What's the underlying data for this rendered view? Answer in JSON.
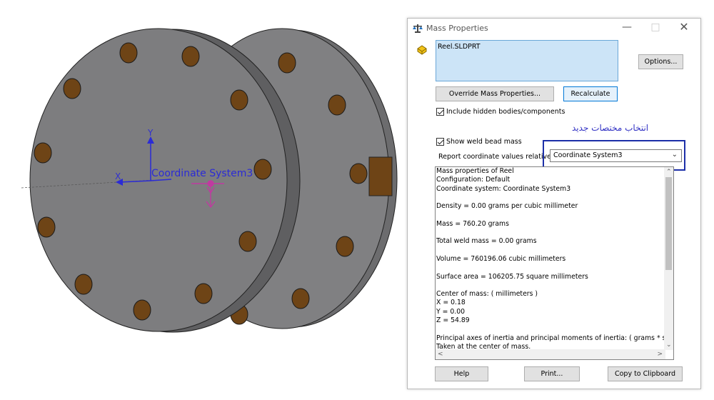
{
  "viewport": {
    "coordinate_label": "Coordinate System3",
    "axis_x": "X",
    "axis_y": "Y",
    "colors": {
      "part_face": "#7d7d7f",
      "part_side": "#6c6c6e",
      "holes": "#6e4416",
      "triad": "#2b2bd6",
      "com_marker": "#c03aa0"
    }
  },
  "dialog": {
    "title": "Mass Properties",
    "selection": "Reel.SLDPRT",
    "options_label": "Options...",
    "override_label": "Override Mass Properties...",
    "recalculate_label": "Recalculate",
    "include_hidden_label": "Include hidden bodies/components",
    "show_weld_label": "Show weld bead mass",
    "annotation_text": "انتخاب مختصات جدید",
    "report_label": "Report coordinate values relative to:",
    "coord_system_value": "Coordinate System3",
    "results_lines": [
      "Mass properties of Reel",
      "     Configuration: Default",
      "     Coordinate system: Coordinate System3",
      "",
      "Density = 0.00 grams per cubic millimeter",
      "",
      "Mass = 760.20 grams",
      "",
      "Total weld mass = 0.00 grams",
      "",
      "Volume = 760196.06 cubic millimeters",
      "",
      "Surface area = 106205.75  square millimeters",
      "",
      "Center of mass: ( millimeters )",
      "      X = 0.18",
      "      Y = 0.00",
      "      Z = 54.89",
      "",
      "Principal axes of inertia and principal moments of inertia: ( grams *  square",
      "Taken at the center of mass."
    ],
    "help_label": "Help",
    "print_label": "Print...",
    "copy_label": "Copy to Clipboard"
  }
}
